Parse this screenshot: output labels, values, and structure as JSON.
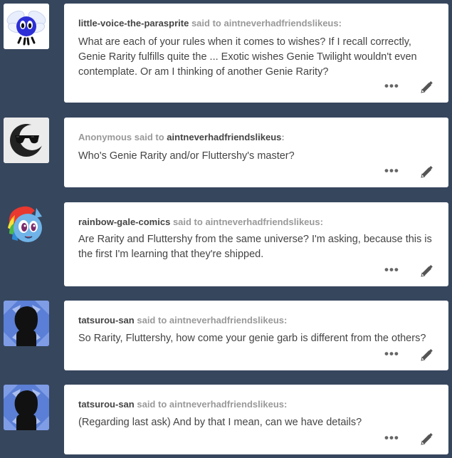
{
  "posts": [
    {
      "asker": "little-voice-the-parasprite",
      "said_to": "said to",
      "recipient": "aintneverhadfriendslikeus",
      "suffix": ":",
      "question": "What are each of your rules when it comes to wishes? If I recall correctly, Genie Rarity fulfills quite the ... Exotic wishes Genie Twilight wouldn't even contemplate. Or am I thinking of another Genie Rarity?",
      "avatar_icon": "parasprite-avatar-icon"
    },
    {
      "asker": "Anonymous",
      "said_to": "said to",
      "recipient": "aintneverhadfriendslikeus",
      "suffix": ":",
      "question": "Who's Genie Rarity and/or Fluttershy's master?",
      "avatar_icon": "anonymous-sunglasses-avatar-icon"
    },
    {
      "asker": "rainbow-gale-comics",
      "said_to": "said to",
      "recipient": "aintneverhadfriendslikeus",
      "suffix": ":",
      "question": "Are Rarity and Fluttershy from the same universe? I'm asking, because this is the first I'm learning that they're shipped.",
      "avatar_icon": "pony-avatar-icon"
    },
    {
      "asker": "tatsurou-san",
      "said_to": "said to",
      "recipient": "aintneverhadfriendslikeus",
      "suffix": ":",
      "question": "So Rarity, Fluttershy, how come your genie garb is different from the others?",
      "avatar_icon": "default-silhouette-avatar-icon"
    },
    {
      "asker": "tatsurou-san",
      "said_to": "said to",
      "recipient": "aintneverhadfriendslikeus",
      "suffix": ":",
      "question": "(Regarding last ask) And by that I mean, can we have details?",
      "avatar_icon": "default-silhouette-avatar-icon"
    }
  ],
  "controls": {
    "more_label": "•••",
    "more_icon": "more-options-icon",
    "edit_icon": "pencil-edit-icon"
  },
  "colors": {
    "background": "#36465d",
    "card": "#ffffff",
    "asker_name": "#444444",
    "secondary_text": "#999999"
  }
}
